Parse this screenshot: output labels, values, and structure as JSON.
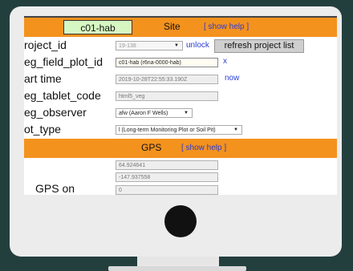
{
  "site_header": {
    "site_code": "c01-hab",
    "title": "Site",
    "help": "[ show help ]"
  },
  "fields": [
    {
      "label": "roject_id",
      "value": "19-138",
      "control": "select",
      "link": "unlock",
      "button": "refresh project list"
    },
    {
      "label": "eg_field_plot_id",
      "value": "c01-hab (r6na-0000-hab)",
      "control": "text",
      "link": "x"
    },
    {
      "label": "art time",
      "value": "2019-10-28T22:55:33.190Z",
      "control": "text",
      "link": "now"
    },
    {
      "label": "eg_tablet_code",
      "value": "html5_veg",
      "control": "text"
    },
    {
      "label": "eg_observer",
      "value": "afw (Aaron F Wells)",
      "control": "select"
    },
    {
      "label": "ot_type",
      "value": "l (Long-term Monitoring Plot or Soil Pit)",
      "control": "select"
    }
  ],
  "gps_header": {
    "title": "GPS",
    "help": "[ show help ]"
  },
  "gps": {
    "latitude": "64.924641",
    "longitude": "-147.937558",
    "gps_on_label": "GPS on",
    "third_value": "0"
  }
}
